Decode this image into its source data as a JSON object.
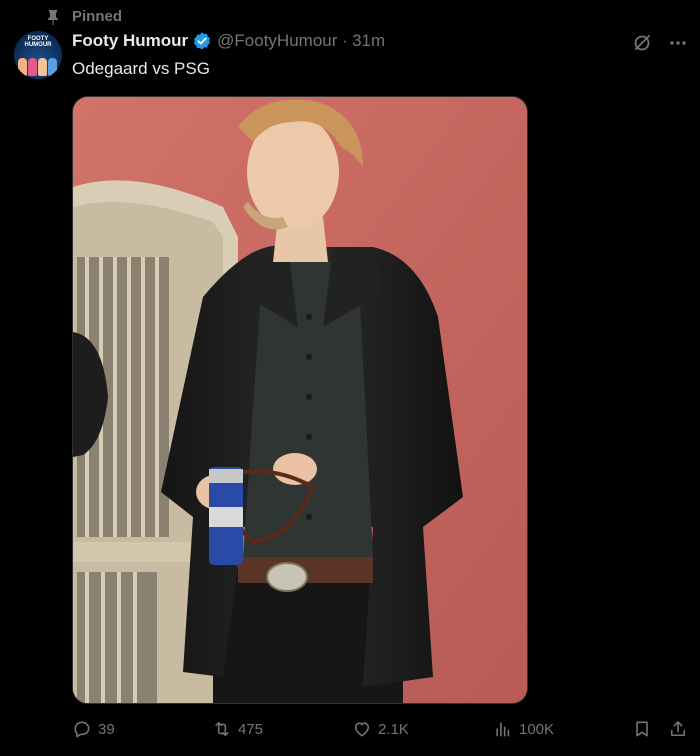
{
  "pinned": {
    "label": "Pinned",
    "icon": "pin-icon"
  },
  "author": {
    "avatar_text": "FOOTY HUMOUR",
    "display_name": "Footy Humour",
    "verified_icon": "verified-badge-icon",
    "handle": "@FootyHumour",
    "separator": "·",
    "time": "31m"
  },
  "tweet": {
    "text": "Odegaard vs PSG"
  },
  "media": {
    "description_icon": "photo",
    "wall_color": "#c86a62"
  },
  "actions": {
    "replies": "39",
    "reposts": "475",
    "likes": "2.1K",
    "views": "100K"
  },
  "colors": {
    "accent": "#1d9bf0",
    "muted": "#71767b",
    "text": "#e7e9ea",
    "background": "#000000"
  }
}
